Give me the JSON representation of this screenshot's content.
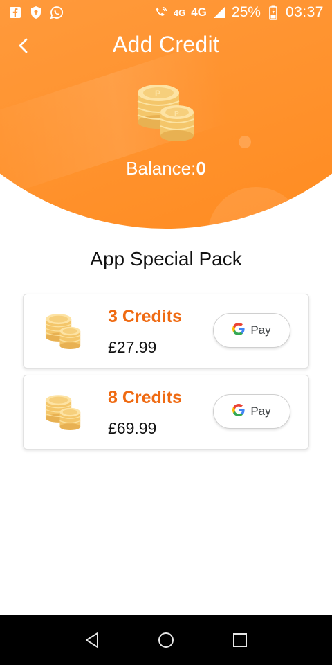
{
  "status_bar": {
    "left_icons": [
      "facebook-icon",
      "shield-icon",
      "whatsapp-icon"
    ],
    "right_icons": [
      "wifi-call-icon",
      "signal-icon",
      "battery-icon"
    ],
    "network_1": "4G",
    "network_2": "4G",
    "battery_percent": "25%",
    "time": "03:37"
  },
  "header": {
    "title": "Add Credit",
    "back_icon": "chevron-left-icon",
    "coins_icon": "coin-stack-icon",
    "balance_label": "Balance:",
    "balance_value": "0"
  },
  "section": {
    "title": "App Special Pack"
  },
  "packs": [
    {
      "credits": "3 Credits",
      "price": "£27.99",
      "pay_label": "Pay",
      "pay_icon": "google-g-icon"
    },
    {
      "credits": "8 Credits",
      "price": "£69.99",
      "pay_label": "Pay",
      "pay_icon": "google-g-icon"
    }
  ],
  "nav_bar": {
    "icons": [
      "back-triangle-icon",
      "home-circle-icon",
      "recents-square-icon"
    ]
  },
  "colors": {
    "header_orange": "#ff9a3c",
    "credits_orange": "#ef6a12",
    "coin_gold": "#f7d27a"
  }
}
